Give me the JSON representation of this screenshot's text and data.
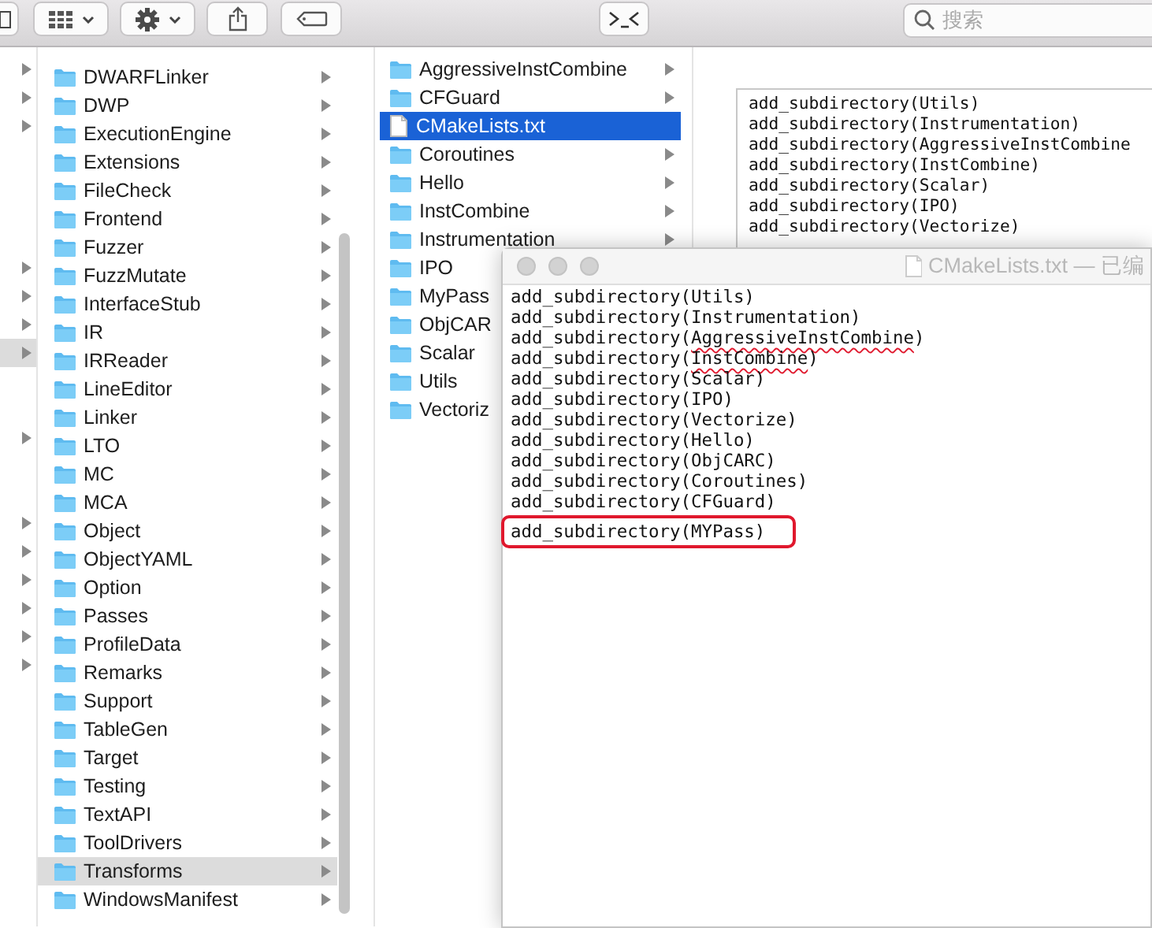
{
  "toolbar": {
    "buttons": [
      {
        "kind": "sidebar"
      },
      {
        "kind": "view"
      },
      {
        "kind": "action"
      },
      {
        "kind": "share"
      },
      {
        "kind": "tag"
      },
      {
        "kind": "terminal"
      }
    ],
    "search": {
      "placeholder": "搜索"
    }
  },
  "column_1": [
    {
      "expandable": true,
      "selected": false
    },
    {
      "expandable": true,
      "selected": false
    },
    {
      "expandable": true,
      "selected": false
    },
    {
      "expandable": false,
      "selected": false
    },
    {
      "expandable": false,
      "selected": false
    },
    {
      "expandable": false,
      "selected": false
    },
    {
      "expandable": false,
      "selected": false
    },
    {
      "expandable": true,
      "selected": false
    },
    {
      "expandable": true,
      "selected": false
    },
    {
      "expandable": true,
      "selected": false
    },
    {
      "expandable": true,
      "selected": true
    },
    {
      "expandable": false,
      "selected": false
    },
    {
      "expandable": false,
      "selected": false
    },
    {
      "expandable": true,
      "selected": false
    },
    {
      "expandable": false,
      "selected": false
    },
    {
      "expandable": false,
      "selected": false
    },
    {
      "expandable": true,
      "selected": false
    },
    {
      "expandable": true,
      "selected": false
    },
    {
      "expandable": true,
      "selected": false
    },
    {
      "expandable": true,
      "selected": false
    },
    {
      "expandable": true,
      "selected": false
    },
    {
      "expandable": true,
      "selected": false
    }
  ],
  "column_2": [
    {
      "name": "DWARFLinker",
      "selected": false
    },
    {
      "name": "DWP",
      "selected": false
    },
    {
      "name": "ExecutionEngine",
      "selected": false
    },
    {
      "name": "Extensions",
      "selected": false
    },
    {
      "name": "FileCheck",
      "selected": false
    },
    {
      "name": "Frontend",
      "selected": false
    },
    {
      "name": "Fuzzer",
      "selected": false
    },
    {
      "name": "FuzzMutate",
      "selected": false
    },
    {
      "name": "InterfaceStub",
      "selected": false
    },
    {
      "name": "IR",
      "selected": false
    },
    {
      "name": "IRReader",
      "selected": false
    },
    {
      "name": "LineEditor",
      "selected": false
    },
    {
      "name": "Linker",
      "selected": false
    },
    {
      "name": "LTO",
      "selected": false
    },
    {
      "name": "MC",
      "selected": false
    },
    {
      "name": "MCA",
      "selected": false
    },
    {
      "name": "Object",
      "selected": false
    },
    {
      "name": "ObjectYAML",
      "selected": false
    },
    {
      "name": "Option",
      "selected": false
    },
    {
      "name": "Passes",
      "selected": false
    },
    {
      "name": "ProfileData",
      "selected": false
    },
    {
      "name": "Remarks",
      "selected": false
    },
    {
      "name": "Support",
      "selected": false
    },
    {
      "name": "TableGen",
      "selected": false
    },
    {
      "name": "Target",
      "selected": false
    },
    {
      "name": "Testing",
      "selected": false
    },
    {
      "name": "TextAPI",
      "selected": false
    },
    {
      "name": "ToolDrivers",
      "selected": false
    },
    {
      "name": "Transforms",
      "selected": true
    },
    {
      "name": "WindowsManifest",
      "selected": false
    }
  ],
  "column_3": [
    {
      "name": "AggressiveInstCombine",
      "kind": "folder",
      "expandable": true,
      "selected": false
    },
    {
      "name": "CFGuard",
      "kind": "folder",
      "expandable": true,
      "selected": false
    },
    {
      "name": "CMakeLists.txt",
      "kind": "file",
      "expandable": false,
      "selected": true
    },
    {
      "name": "Coroutines",
      "kind": "folder",
      "expandable": true,
      "selected": false
    },
    {
      "name": "Hello",
      "kind": "folder",
      "expandable": true,
      "selected": false
    },
    {
      "name": "InstCombine",
      "kind": "folder",
      "expandable": true,
      "selected": false
    },
    {
      "name": "Instrumentation",
      "kind": "folder",
      "expandable": true,
      "selected": false
    },
    {
      "name": "IPO",
      "kind": "folder",
      "selected": false
    },
    {
      "name": "MyPass",
      "kind": "folder",
      "selected": false
    },
    {
      "name": "ObjCAR",
      "kind": "folder",
      "selected": false
    },
    {
      "name": "Scalar",
      "kind": "folder",
      "selected": false
    },
    {
      "name": "Utils",
      "kind": "folder",
      "selected": false
    },
    {
      "name": "Vectoriz",
      "kind": "folder",
      "selected": false
    }
  ],
  "preview": {
    "lines": [
      "add_subdirectory(Utils)",
      "add_subdirectory(Instrumentation)",
      "add_subdirectory(AggressiveInstCombine",
      "add_subdirectory(InstCombine)",
      "add_subdirectory(Scalar)",
      "add_subdirectory(IPO)",
      "add_subdirectory(Vectorize)"
    ]
  },
  "editor": {
    "title": "CMakeLists.txt — 已编",
    "lines": [
      {
        "text": "add_subdirectory(Utils)",
        "misspelled": false,
        "highlighted": false
      },
      {
        "text": "add_subdirectory(Instrumentation)",
        "misspelled": false,
        "highlighted": false
      },
      {
        "text": "add_subdirectory(AggressiveInstCombine)",
        "misspelled": true,
        "highlighted": false
      },
      {
        "text": "add_subdirectory(InstCombine)",
        "misspelled": true,
        "highlighted": false
      },
      {
        "text": "add_subdirectory(Scalar)",
        "misspelled": false,
        "highlighted": false
      },
      {
        "text": "add_subdirectory(IPO)",
        "misspelled": false,
        "highlighted": false
      },
      {
        "text": "add_subdirectory(Vectorize)",
        "misspelled": false,
        "highlighted": false
      },
      {
        "text": "add_subdirectory(Hello)",
        "misspelled": false,
        "highlighted": false
      },
      {
        "text": "add_subdirectory(ObjCARC)",
        "misspelled": false,
        "highlighted": false
      },
      {
        "text": "add_subdirectory(Coroutines)",
        "misspelled": false,
        "highlighted": false
      },
      {
        "text": "add_subdirectory(CFGuard)",
        "misspelled": false,
        "highlighted": false
      },
      {
        "text": "add_subdirectory(MYPass)",
        "misspelled": false,
        "highlighted": true
      }
    ]
  }
}
